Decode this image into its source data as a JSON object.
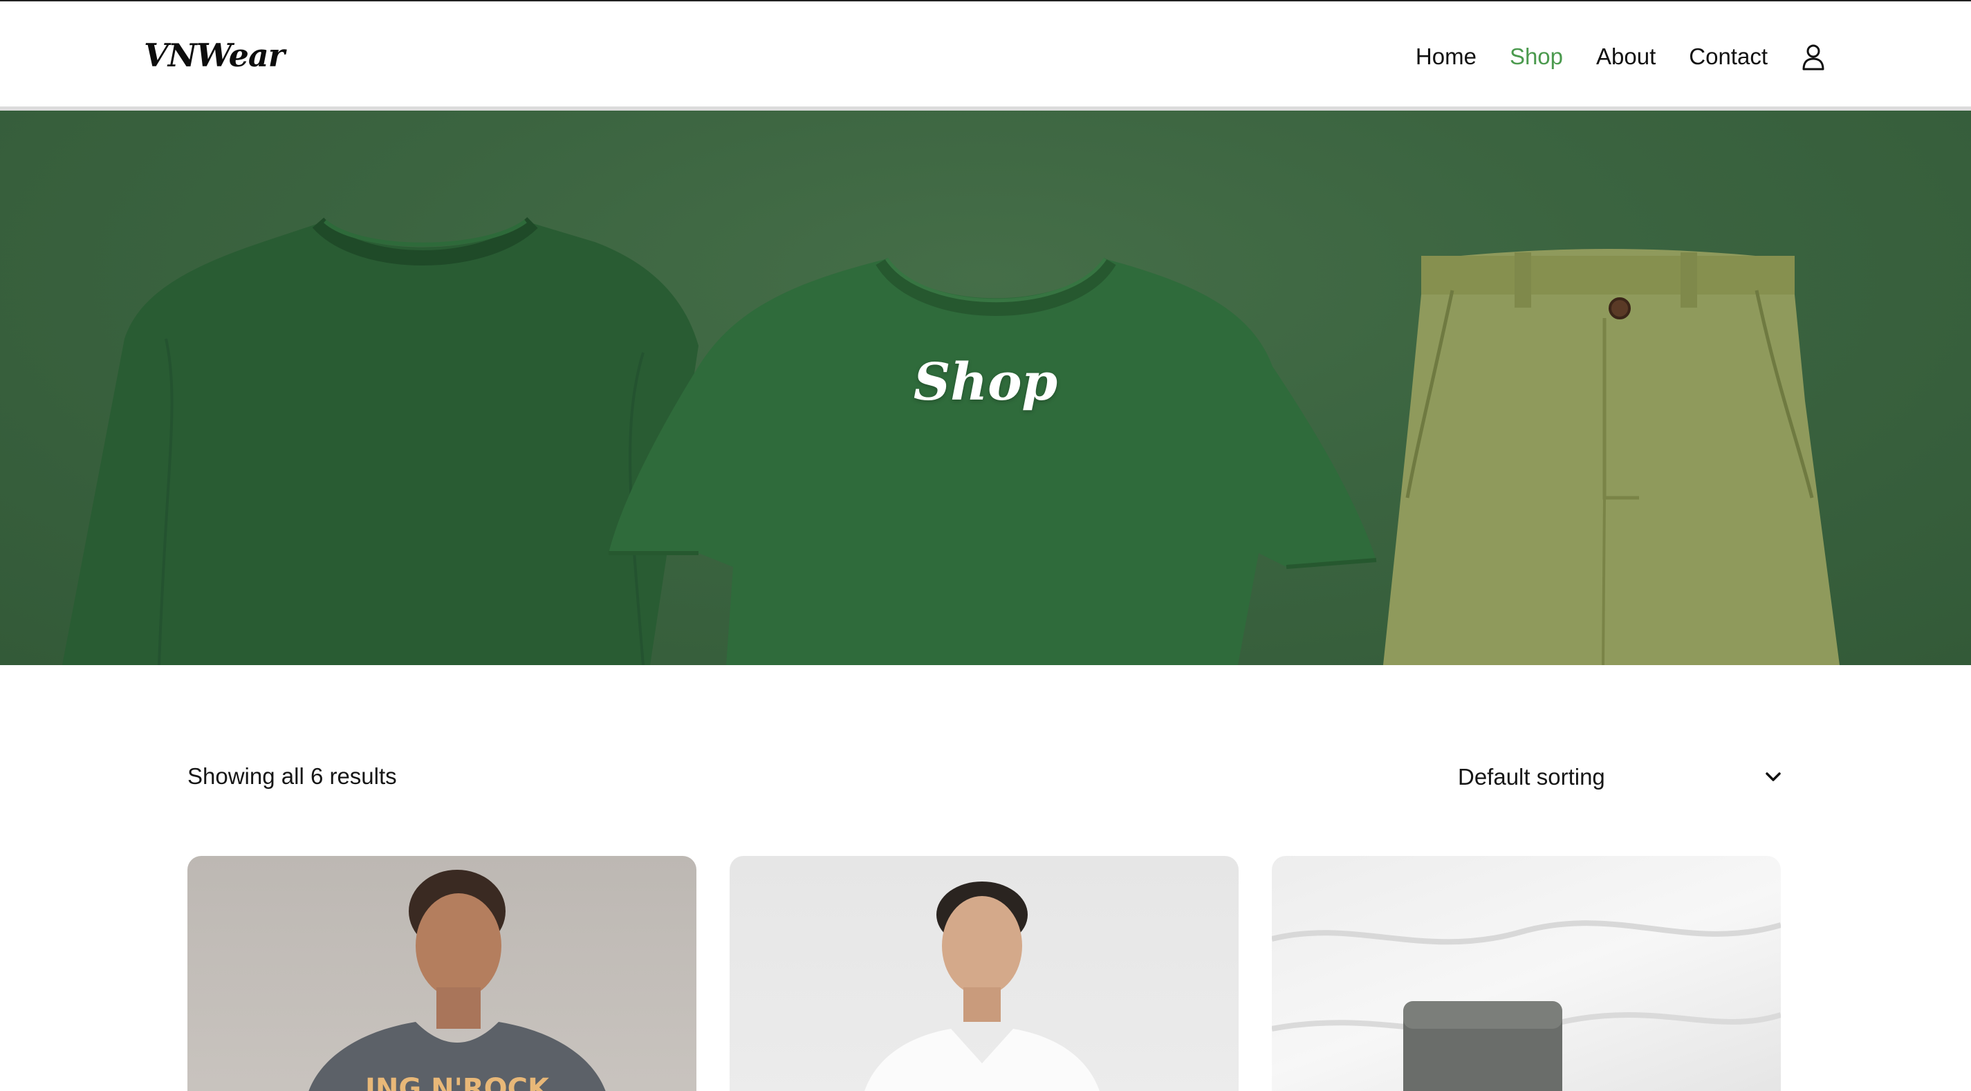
{
  "brand": {
    "logo_text": "VNWear"
  },
  "nav": {
    "items": [
      {
        "label": "Home",
        "active": false
      },
      {
        "label": "Shop",
        "active": true
      },
      {
        "label": "About",
        "active": false
      },
      {
        "label": "Contact",
        "active": false
      }
    ],
    "account_icon": "user-icon",
    "active_color": "#4b9a4e"
  },
  "hero": {
    "title": "Shop",
    "background_color": "#3b6440"
  },
  "shop": {
    "results_text": "Showing all 6 results",
    "sort": {
      "selected": "Default sorting",
      "icon": "chevron-down-icon"
    }
  },
  "products": [
    {
      "image_desc": "product-image-graphic-tee"
    },
    {
      "image_desc": "product-image-white-vneck"
    },
    {
      "image_desc": "product-image-knit-socks"
    }
  ]
}
